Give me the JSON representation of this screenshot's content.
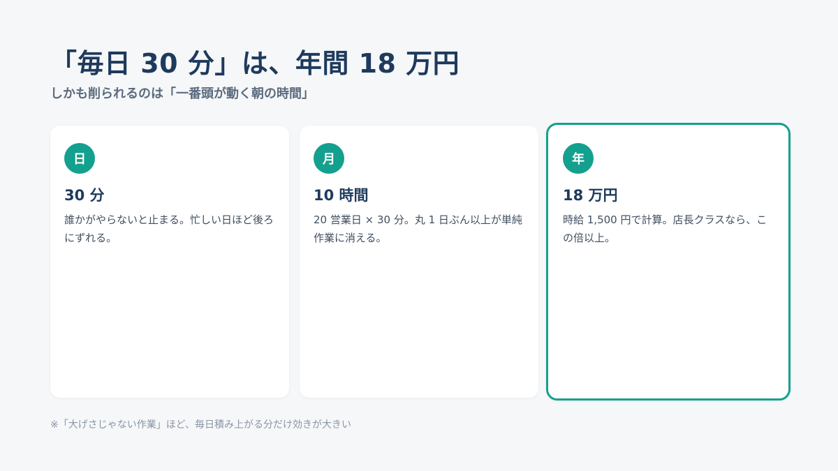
{
  "heading": {
    "title": "「毎日 30 分」は、年間 18 万円",
    "subtitle": "しかも削られるのは「一番頭が動く朝の時間」"
  },
  "cards": [
    {
      "badge": "日",
      "title": "30 分",
      "body": "誰かがやらないと止まる。忙しい日ほど後ろにずれる。"
    },
    {
      "badge": "月",
      "title": "10 時間",
      "body": "20 営業日 × 30 分。丸 1 日ぶん以上が単純作業に消える。"
    },
    {
      "badge": "年",
      "title": "18 万円",
      "body": "時給 1,500 円で計算。店長クラスなら、この倍以上。"
    }
  ],
  "footnote": "※「大げさじゃない作業」ほど、毎日積み上がる分だけ効きが大きい",
  "colors": {
    "accent": "#14a08e",
    "heading": "#1e3a5c",
    "background": "#f6f7f9"
  }
}
